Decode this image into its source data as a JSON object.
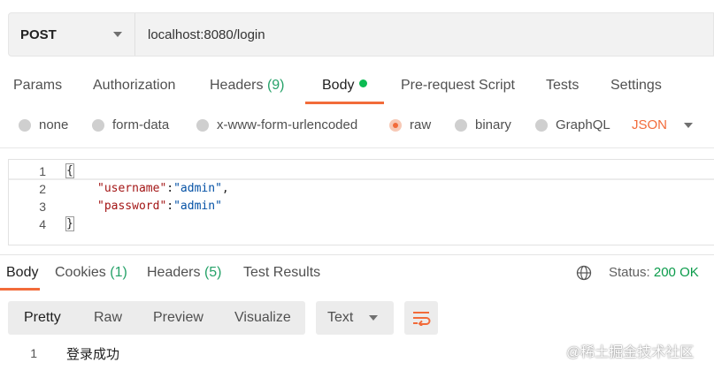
{
  "request": {
    "method": "POST",
    "url": "localhost:8080/login"
  },
  "request_tabs": [
    {
      "label": "Params",
      "count": ""
    },
    {
      "label": "Authorization",
      "count": ""
    },
    {
      "label": "Headers",
      "count": "(9)"
    },
    {
      "label": "Body",
      "count": ""
    },
    {
      "label": "Pre-request Script",
      "count": ""
    },
    {
      "label": "Tests",
      "count": ""
    },
    {
      "label": "Settings",
      "count": ""
    }
  ],
  "body_types": [
    "none",
    "form-data",
    "x-www-form-urlencoded",
    "raw",
    "binary",
    "GraphQL"
  ],
  "body_format": "JSON",
  "editor_lines": [
    {
      "n": "1"
    },
    {
      "n": "2"
    },
    {
      "n": "3"
    },
    {
      "n": "4"
    }
  ],
  "code": {
    "open": "{",
    "close": "}",
    "username_key": "\"username\"",
    "username_val": "\"admin\"",
    "password_key": "\"password\"",
    "password_val": "\"admin\"",
    "colon": ":",
    "comma": ","
  },
  "response_tabs": [
    {
      "label": "Body",
      "count": ""
    },
    {
      "label": "Cookies",
      "count": "(1)"
    },
    {
      "label": "Headers",
      "count": "(5)"
    },
    {
      "label": "Test Results",
      "count": ""
    }
  ],
  "status": {
    "label": "Status:",
    "value": "200 OK"
  },
  "view_modes": [
    "Pretty",
    "Raw",
    "Preview",
    "Visualize"
  ],
  "response_format": "Text",
  "response": {
    "line": "1",
    "text": "登录成功"
  },
  "watermark": "@稀土掘金技术社区",
  "colors": {
    "accent": "#f26b3a",
    "success": "#0a9b4a",
    "dot": "#0cbb52"
  }
}
